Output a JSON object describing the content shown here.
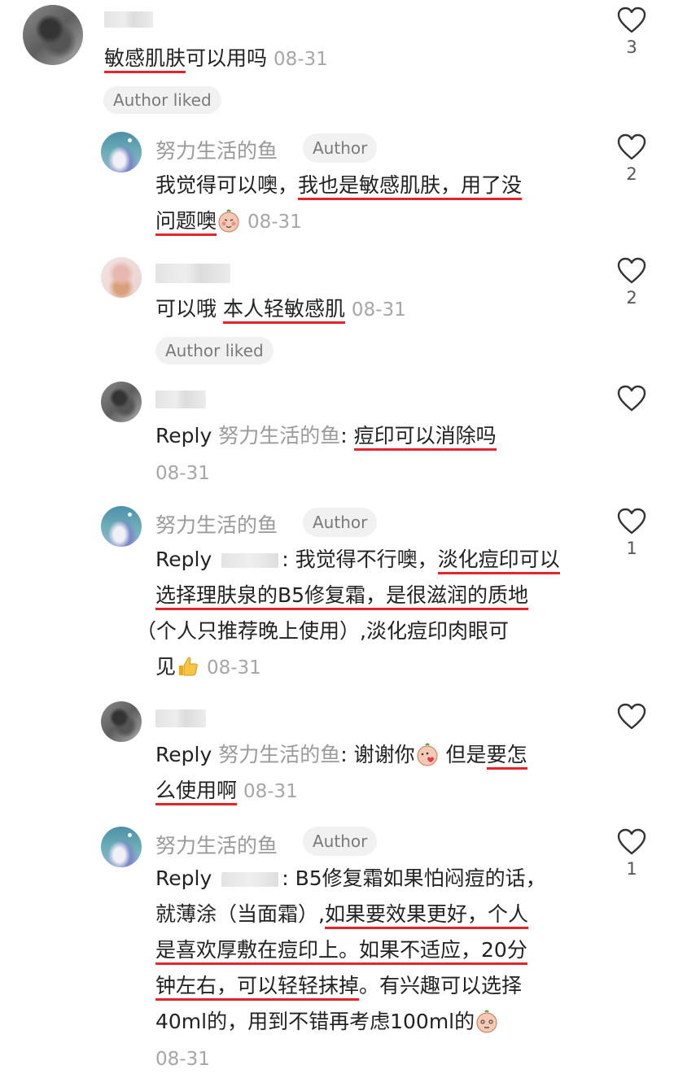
{
  "comments": [
    {
      "username_masked": true,
      "text_segments": [
        {
          "t": "敏感肌肤",
          "hl": true
        },
        {
          "t": "可以用吗",
          "hl": false
        }
      ],
      "date": "08-31",
      "author_liked": "Author liked",
      "likes": "3"
    },
    {
      "username": "努力生活的鱼",
      "author_tag": "Author",
      "line1": [
        {
          "t": "我觉得可以噢，",
          "hl": false
        },
        {
          "t": "我也是敏感肌肤，用了没",
          "hl": true
        }
      ],
      "line2": [
        {
          "t": "问题噢",
          "hl": true
        }
      ],
      "date": "08-31",
      "likes": "2"
    },
    {
      "username_masked": true,
      "text_segments": [
        {
          "t": "可以哦 ",
          "hl": false
        },
        {
          "t": "本人轻敏感肌",
          "hl": true
        }
      ],
      "date": "08-31",
      "author_liked": "Author liked",
      "likes": "2"
    },
    {
      "username_masked": true,
      "reply_label": "Reply",
      "reply_to": "努力生活的鱼",
      "text": "痘印可以消除吗",
      "date": "08-31",
      "likes": ""
    },
    {
      "username": "努力生活的鱼",
      "author_tag": "Author",
      "reply_label": "Reply",
      "line1": "我觉得不行噢，",
      "line1_hl": "淡化痘印可以",
      "line2": "选择理肤泉的B5修复霜，是很滋润的质地",
      "line3": "（个人只推荐晚上使用）,淡化痘印肉眼可",
      "line4": "见",
      "date": "08-31",
      "likes": "1"
    },
    {
      "username_masked": true,
      "reply_label": "Reply",
      "reply_to": "努力生活的鱼",
      "line1_pre": "谢谢你",
      "line1_mid": " 但是",
      "line1_hl": "要怎",
      "line2_hl": "么使用啊",
      "date": "08-31",
      "likes": ""
    },
    {
      "username": "努力生活的鱼",
      "author_tag": "Author",
      "reply_label": "Reply",
      "line1": "B5修复霜如果怕闷痘的话，",
      "line2_pre": "就薄涂（当面霜）,",
      "line2_hl": "如果要效果更好，个人",
      "line3_hl": "是喜欢厚敷在痘印上。如果不适应，20分",
      "line4_hl": "钟左右，可以轻轻抹掉",
      "line4_post": "。有兴趣可以选择",
      "line5": "40ml的，用到不错再考虑100ml的",
      "date": "08-31",
      "likes": "1"
    }
  ],
  "icons": {
    "like": "heart-outline-icon",
    "emoji_peach_smile": "peach-blush-emoji",
    "emoji_thumbs": "thumbs-up-emoji",
    "emoji_peach_heart": "peach-heart-emoji",
    "emoji_peach_think": "peach-think-emoji"
  },
  "colors": {
    "highlight_underline": "#e3242b",
    "meta_gray": "#9a9a9a",
    "tag_bg": "#f1f1f1"
  }
}
